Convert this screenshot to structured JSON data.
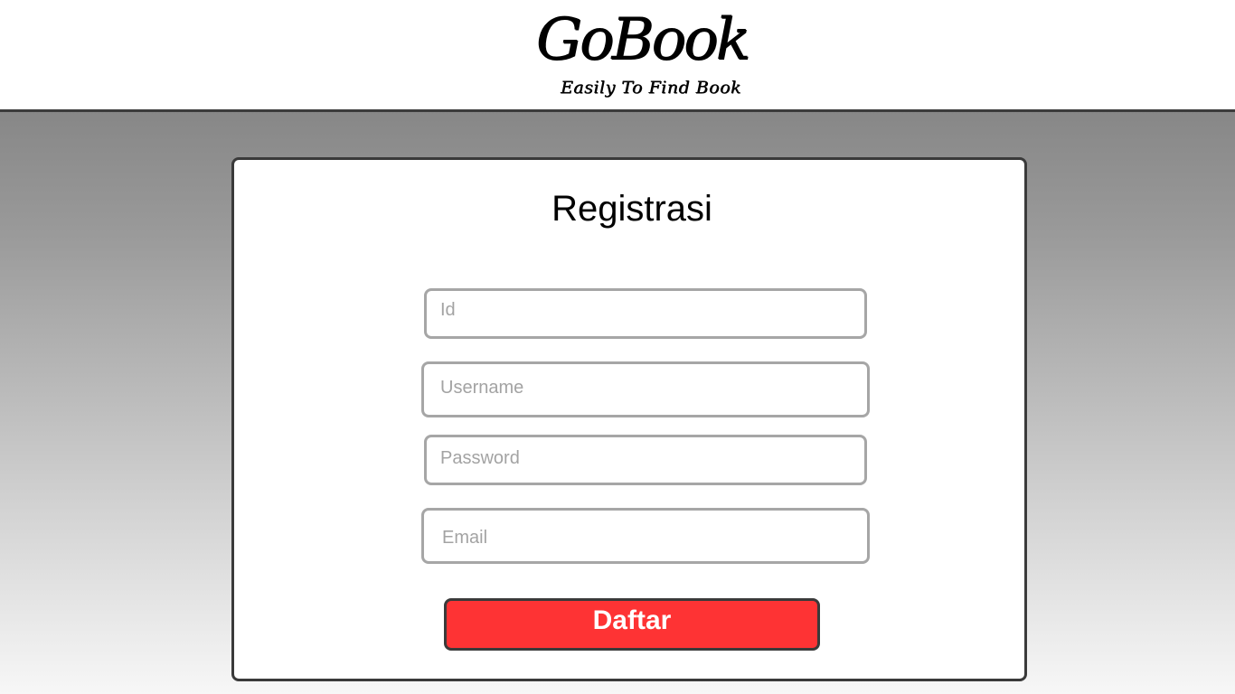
{
  "header": {
    "logo_title": "GoBook",
    "logo_tagline": "Easily To Find Book"
  },
  "form": {
    "title": "Registrasi",
    "id_placeholder": "Id",
    "username_placeholder": "Username",
    "password_placeholder": "Password",
    "email_placeholder": "Email",
    "submit_label": "Daftar"
  },
  "colors": {
    "button_red": "#fe3334",
    "input_border": "#a6a6a6",
    "card_border": "#3a3a3a"
  }
}
